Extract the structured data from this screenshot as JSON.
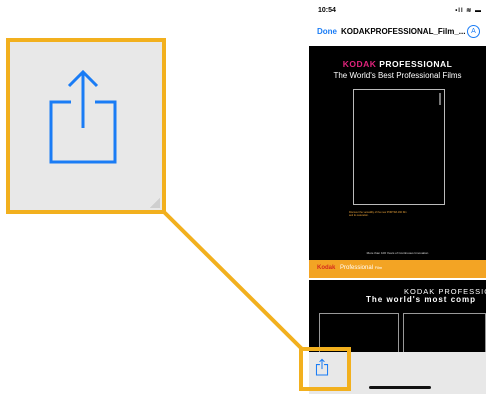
{
  "status_bar": {
    "time": "10:54",
    "icons": "•ll ≋ ▬"
  },
  "nav_bar": {
    "done_label": "Done",
    "title": "KODAKPROFESSIONAL_Film_...",
    "markup_label": "A"
  },
  "page1": {
    "brand_kodak": "KODAK",
    "brand_pro": "PROFESSIONAL",
    "tagline": "The World's Best Professional Films",
    "small_text": "Discover the versatility of the new PORTRA 160 film and its saturation.",
    "more_than": "More than 100 Years of Continuous Innovation"
  },
  "band": {
    "kodak": "Kodak",
    "professional": "Professional",
    "film": "Film"
  },
  "page2": {
    "title": "KODAK PROFESSIONAL",
    "subtitle": "The world's most comp"
  },
  "toolbar": {
    "share_icon": "share-icon"
  },
  "colors": {
    "highlight": "#f2b01e",
    "ios_blue": "#1a7cf5",
    "kodak_pink": "#e0237c",
    "band_yellow": "#f3a424"
  }
}
